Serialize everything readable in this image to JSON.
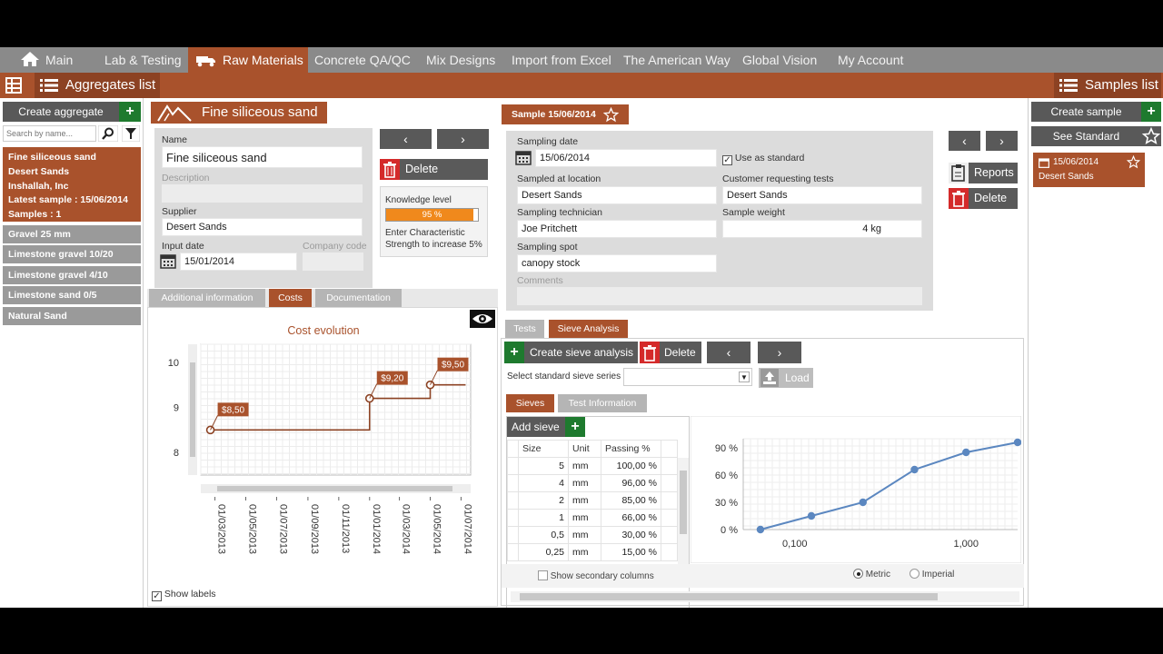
{
  "nav": {
    "items": [
      "Main",
      "Lab & Testing",
      "Raw Materials",
      "Concrete QA/QC",
      "Mix Designs",
      "Import from Excel",
      "The American Way",
      "Global Vision",
      "My Account"
    ]
  },
  "subbar": {
    "aggregates_list": "Aggregates list",
    "samples_list": "Samples list"
  },
  "left": {
    "create_aggregate": "Create aggregate",
    "search_placeholder": "Search by name...",
    "selected": {
      "name": "Fine siliceous sand",
      "supplier": "Desert Sands",
      "company": "Inshallah, Inc",
      "latest_sample": "Latest sample :  15/06/2014",
      "samples": "Samples :  1"
    },
    "items": [
      "Gravel 25 mm",
      "Limestone gravel 10/20",
      "Limestone gravel 4/10",
      "Limestone sand 0/5",
      "Natural Sand"
    ]
  },
  "aggregate": {
    "title": "Fine siliceous sand",
    "name_label": "Name",
    "name_value": "Fine siliceous sand",
    "description_label": "Description",
    "supplier_label": "Supplier",
    "supplier_value": "Desert Sands",
    "input_date_label": "Input date",
    "input_date_value": "15/01/2014",
    "company_code_label": "Company code",
    "delete": "Delete",
    "knowledge_label": "Knowledge level",
    "knowledge_percent": "95 %",
    "knowledge_fraction": 0.95,
    "enter_text": "Enter Characteristic Strength to increase 5%"
  },
  "agg_tabs": [
    "Additional information",
    "Costs",
    "Documentation"
  ],
  "cost_chart": {
    "title": "Cost evolution",
    "show_labels": "Show labels"
  },
  "chart_data": [
    {
      "type": "line",
      "title": "Cost evolution",
      "x": [
        "01/03/2013",
        "01/05/2013",
        "01/07/2013",
        "01/09/2013",
        "01/11/2013",
        "01/01/2014",
        "01/03/2014",
        "01/05/2014",
        "01/07/2014"
      ],
      "series": [
        {
          "points": [
            [
              "2013-02-20",
              8.5
            ],
            [
              "2014-01-01",
              8.5
            ],
            [
              "2014-01-01",
              9.2
            ],
            [
              "2014-05-01",
              9.2
            ],
            [
              "2014-05-01",
              9.5
            ],
            [
              "2014-07-10",
              9.5
            ]
          ]
        }
      ],
      "labels": [
        {
          "x": "2013-02-20",
          "y": 8.5,
          "text": "$8,50"
        },
        {
          "x": "2014-01-01",
          "y": 9.2,
          "text": "$9,20"
        },
        {
          "x": "2014-05-01",
          "y": 9.5,
          "text": "$9,50"
        }
      ],
      "yticks": [
        "8",
        "9",
        "10"
      ],
      "ylim": [
        7.5,
        10.4
      ]
    },
    {
      "type": "line",
      "x_scale": "log",
      "series": [
        {
          "x": [
            0.063,
            0.125,
            0.25,
            0.5,
            1,
            2
          ],
          "y": [
            0,
            15,
            30,
            66,
            85,
            96
          ]
        }
      ],
      "yticks": [
        "0 %",
        "30 %",
        "60 %",
        "90 %"
      ],
      "xticks": [
        "0,100",
        "1,000"
      ],
      "ylim": [
        0,
        100
      ]
    }
  ],
  "sample": {
    "title": "Sample 15/06/2014",
    "sampling_date_label": "Sampling date",
    "sampling_date": "15/06/2014",
    "use_as_standard": "Use as standard",
    "sampled_at_label": "Sampled at location",
    "sampled_at": "Desert Sands",
    "customer_label": "Customer requesting tests",
    "customer": "Desert Sands",
    "technician_label": "Sampling technician",
    "technician": "Joe Pritchett",
    "weight_label": "Sample weight",
    "weight": "4 kg",
    "spot_label": "Sampling spot",
    "spot": "canopy stock",
    "comments_label": "Comments",
    "reports": "Reports",
    "delete": "Delete"
  },
  "sample_tabs": [
    "Tests",
    "Sieve Analysis"
  ],
  "sieve": {
    "create": "Create sieve analysis",
    "delete": "Delete",
    "series_label": "Select standard sieve series",
    "load": "Load",
    "tabs": [
      "Sieves",
      "Test Information"
    ],
    "add_sieve": "Add sieve",
    "columns": [
      "Size",
      "Unit",
      "Passing %"
    ],
    "rows": [
      [
        "5",
        "mm",
        "100,00 %"
      ],
      [
        "4",
        "mm",
        "96,00 %"
      ],
      [
        "2",
        "mm",
        "85,00 %"
      ],
      [
        "1",
        "mm",
        "66,00 %"
      ],
      [
        "0,5",
        "mm",
        "30,00 %"
      ],
      [
        "0,25",
        "mm",
        "15,00 %"
      ]
    ],
    "show_secondary": "Show secondary columns",
    "metric": "Metric",
    "imperial": "Imperial"
  },
  "right": {
    "create_sample": "Create sample",
    "see_standard": "See Standard",
    "sample_date": "15/06/2014",
    "sample_location": "Desert Sands"
  }
}
